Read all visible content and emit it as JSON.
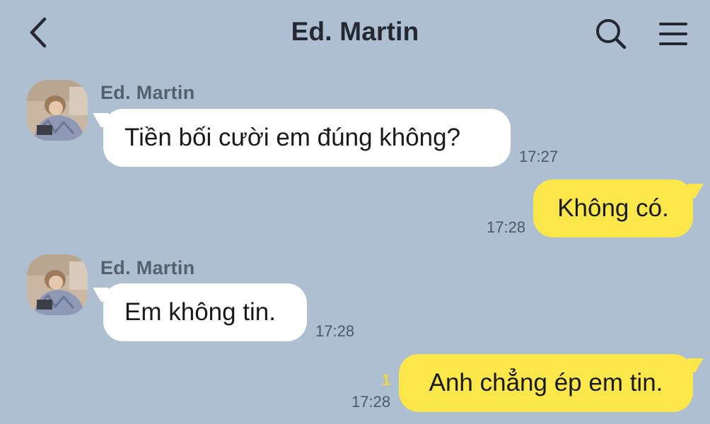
{
  "header": {
    "title": "Ed. Martin",
    "back_icon": "chevron-left-icon",
    "search_icon": "search-icon",
    "menu_icon": "hamburger-menu-icon"
  },
  "colors": {
    "background": "#aebfd1",
    "incoming_bubble": "#ffffff",
    "outgoing_bubble": "#fbe74a",
    "unread_count": "#f2d63a"
  },
  "messages": [
    {
      "direction": "incoming",
      "sender": "Ed. Martin",
      "text": "Tiền bối cười em đúng không?",
      "time": "17:27"
    },
    {
      "direction": "outgoing",
      "text": "Không có.",
      "time": "17:28"
    },
    {
      "direction": "incoming",
      "sender": "Ed. Martin",
      "text": "Em không tin.",
      "time": "17:28"
    },
    {
      "direction": "outgoing",
      "text": "Anh chẳng ép em tin.",
      "time": "17:28",
      "unread": "1"
    }
  ]
}
